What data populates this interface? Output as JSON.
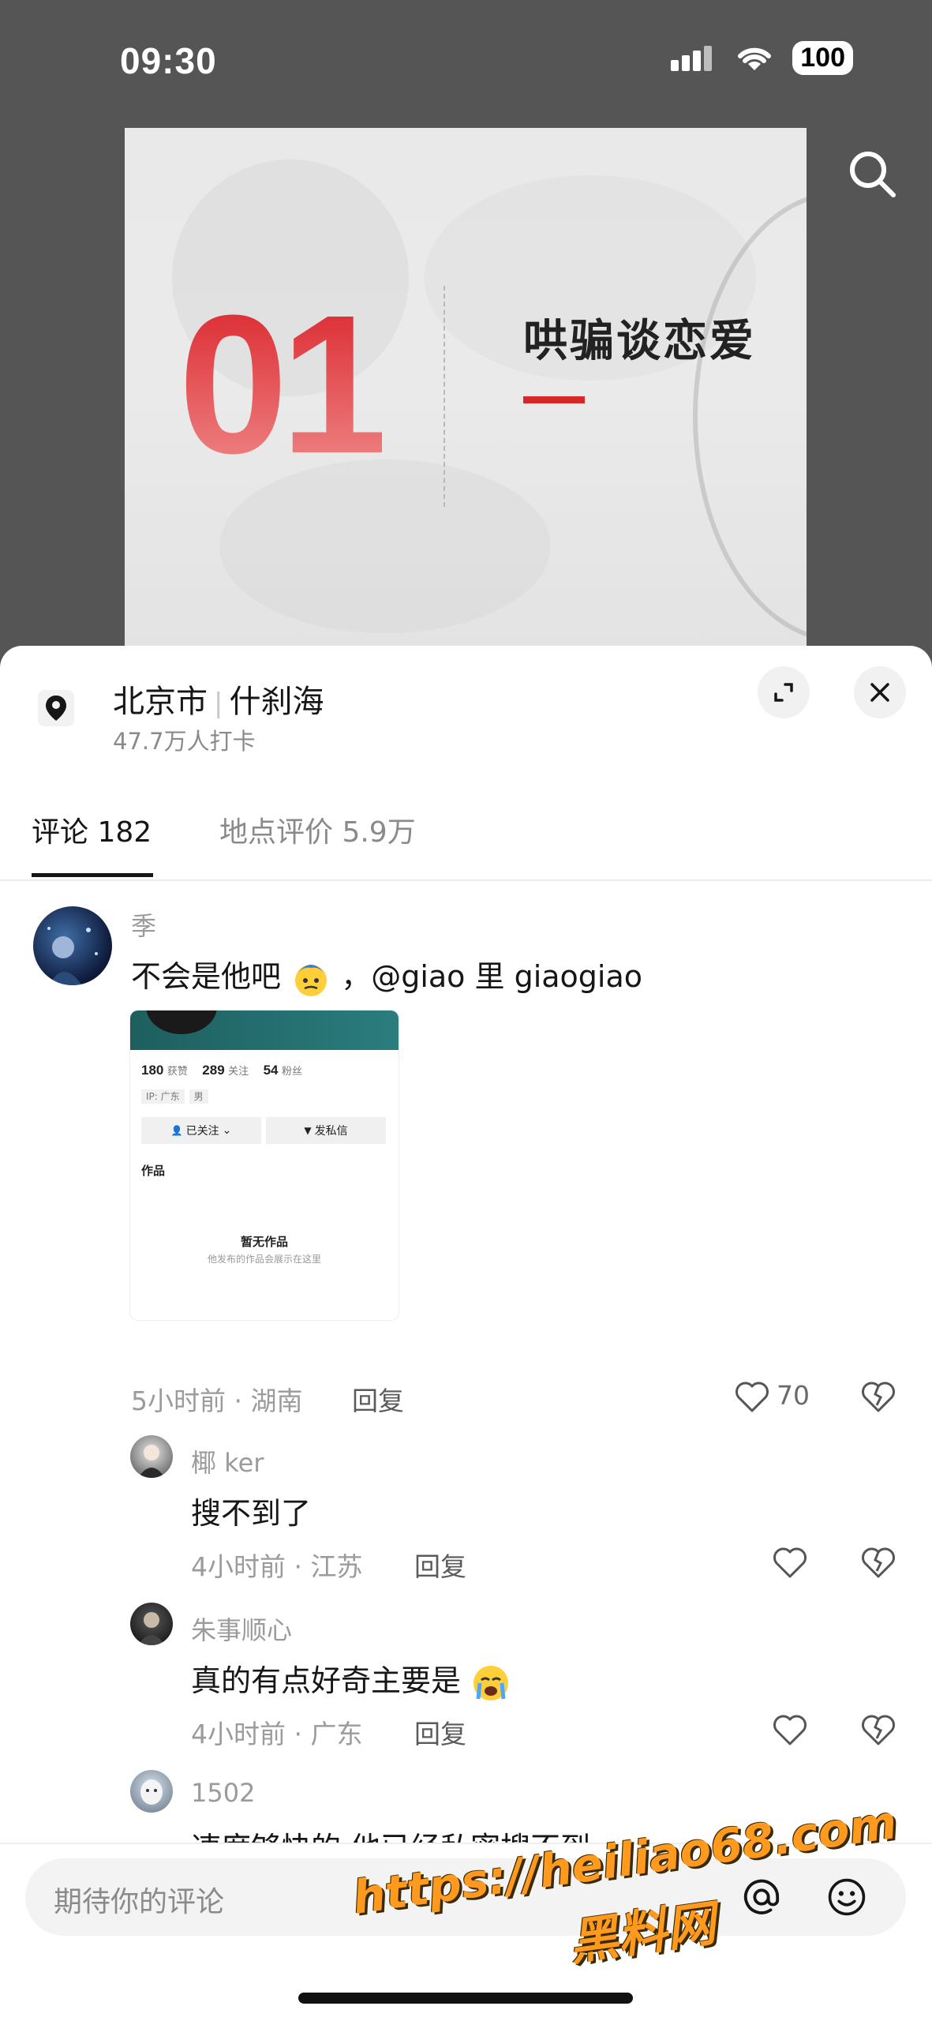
{
  "status_bar": {
    "time": "09:30",
    "battery": "100"
  },
  "video": {
    "big_number": "01",
    "title": "哄骗谈恋爱"
  },
  "location": {
    "city": "北京市",
    "place": "什刹海",
    "checkins": "47.7万人打卡"
  },
  "tabs": [
    {
      "label": "评论 182",
      "active": true
    },
    {
      "label": "地点评价 5.9万",
      "active": false
    }
  ],
  "comments": [
    {
      "user": "季",
      "text": "不会是他吧",
      "mention": "，@giao 里 giaogiao",
      "time_loc": "5小时前 · 湖南",
      "reply": "回复",
      "likes": "70",
      "screenshot": {
        "stats": [
          {
            "n": "180",
            "l": "获赞"
          },
          {
            "n": "289",
            "l": "关注"
          },
          {
            "n": "54",
            "l": "粉丝"
          }
        ],
        "tags": [
          "IP: 广东",
          "男"
        ],
        "btn_follow": "已关注",
        "btn_msg": "发私信",
        "works": "作品",
        "empty_title": "暂无作品",
        "empty_sub": "他发布的作品会展示在这里"
      }
    },
    {
      "user": "椰 ker",
      "text": "搜不到了",
      "time_loc": "4小时前 · 江苏",
      "reply": "回复"
    },
    {
      "user": "朱事顺心",
      "text": "真的有点好奇主要是",
      "time_loc": "4小时前 · 广东",
      "reply": "回复"
    },
    {
      "user": "1502",
      "text": "速度够快的 他已经私密搜不到"
    }
  ],
  "input": {
    "placeholder": "期待你的评论"
  },
  "watermark": {
    "url": "https://heiliao68.com",
    "name": "黑料网"
  }
}
